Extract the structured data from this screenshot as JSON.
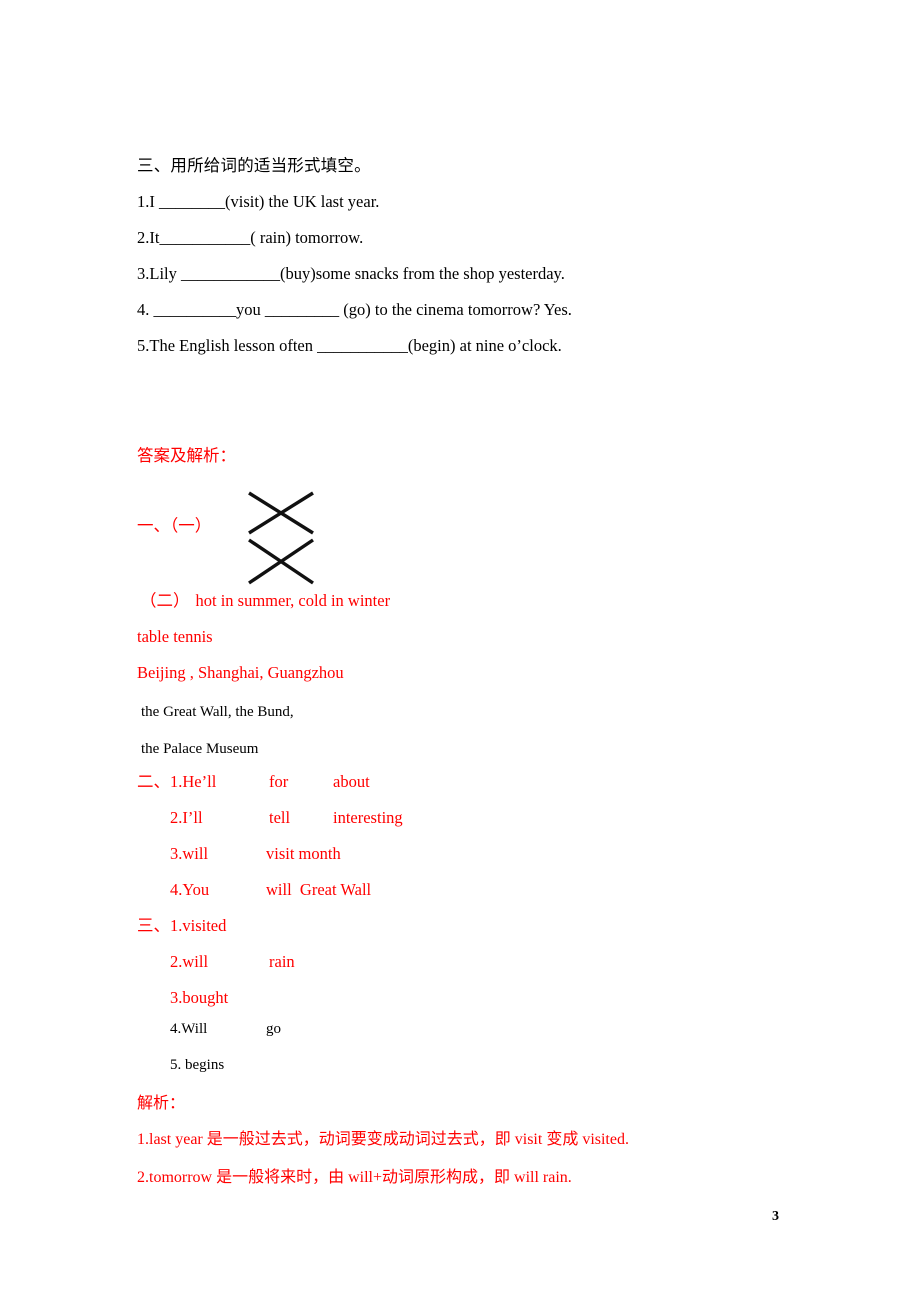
{
  "document": {
    "page_number": "3",
    "colors": {
      "answer_red": "#ff0000",
      "text_black": "#000000",
      "page_background": "#ffffff"
    }
  },
  "exercise": {
    "heading": "三、用所给词的适当形式填空。",
    "items": [
      "1.I ________(visit) the UK last year.",
      "2.It___________( rain) tomorrow.",
      "3.Lily ____________(buy)some snacks from the shop yesterday.",
      "4. __________you _________ (go) to the cinema tomorrow? Yes.",
      "5.The English lesson often ___________(begin) at nine o’clock."
    ]
  },
  "answers": {
    "heading": "答案及解析：",
    "section_one": {
      "label": "一、（一）",
      "drawing": "crossed-matching-lines",
      "part_two_label": "（二）",
      "part_two_text": "hot in summer, cold in winter",
      "lines": [
        "table tennis",
        "Beijing , Shanghai, Guangzhou"
      ],
      "black_lines": [
        "the Great Wall, the Bund,",
        "the Palace Museum"
      ]
    },
    "section_two": {
      "label": "二、",
      "rows": [
        {
          "num": "1.He’ll",
          "c2": "for",
          "c3": "about"
        },
        {
          "num": "2.I’ll",
          "c2": "tell",
          "c3": "interesting"
        },
        {
          "num": "3.will",
          "c2": "visit month",
          "c3": ""
        },
        {
          "num": "4.You",
          "c2": "will  Great Wall",
          "c3": ""
        }
      ]
    },
    "section_three": {
      "label": "三、",
      "rows": [
        {
          "num": "1.visited",
          "c2": "",
          "color": "red"
        },
        {
          "num": "2.will",
          "c2": "rain",
          "color": "red"
        },
        {
          "num": "3.bought",
          "c2": "",
          "color": "red"
        },
        {
          "num": "4.Will",
          "c2": "go",
          "color": "black"
        },
        {
          "num": "5. begins",
          "c2": "",
          "color": "black"
        }
      ]
    }
  },
  "explanation": {
    "heading": "解析：",
    "items": [
      "1.last year 是一般过去式，动词要变成动词过去式，即 visit 变成 visited.",
      "2.tomorrow 是一般将来时，由 will+动词原形构成，即 will rain."
    ]
  }
}
